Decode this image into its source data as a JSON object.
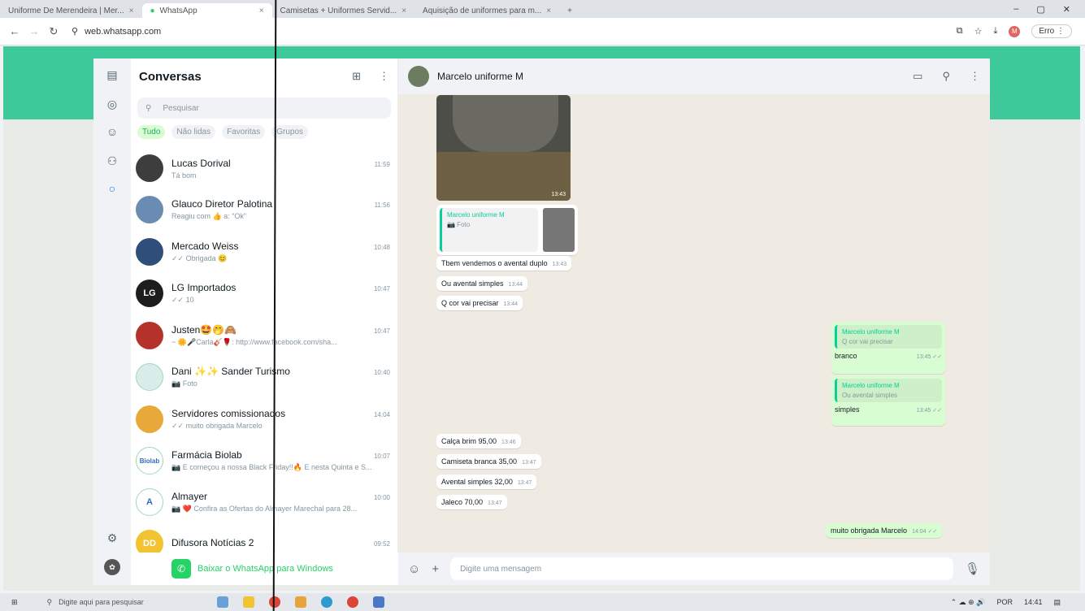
{
  "browser": {
    "tabs": [
      {
        "label": "Uniforme De Merendeira | Mer...",
        "active": false
      },
      {
        "label": "WhatsApp",
        "active": true
      },
      {
        "label": "Camisetas + Uniformes Servid...",
        "active": false
      },
      {
        "label": "Aquisição de uniformes para m...",
        "active": false
      }
    ],
    "url": "web.whatsapp.com",
    "error_label": "Erro"
  },
  "sidebar": {
    "title": "Conversas",
    "search_placeholder": "Pesquisar",
    "filters": [
      "Tudo",
      "Não lidas",
      "Favoritas",
      "Grupos"
    ],
    "chats": [
      {
        "name": "Lucas Dorival",
        "msg": "Tá bom",
        "time": "11:59",
        "color": "#3d3d3d",
        "initials": ""
      },
      {
        "name": "Glauco Diretor Palotina",
        "msg": "Reagiu com 👍 a: \"Ok\"",
        "time": "11:56",
        "color": "#6a8bb2",
        "initials": ""
      },
      {
        "name": "Mercado Weiss",
        "msg": "✓✓ Obrigada 😊",
        "time": "10:48",
        "color": "#2f4f7a",
        "initials": ""
      },
      {
        "name": "LG Importados",
        "msg": "✓✓ 10",
        "time": "10:47",
        "color": "#1d1d1d",
        "initials": "LG"
      },
      {
        "name": "Justen🤩🤭🙈",
        "msg": "~ 🌼🎤Carla🎸🌹: http://www.facebook.com/sha...",
        "time": "10:47",
        "color": "#b5322b",
        "initials": ""
      },
      {
        "name": "Dani ✨✨ Sander Turismo",
        "msg": "📷 Foto",
        "time": "10:40",
        "color": "#d8ecec",
        "initials": ""
      },
      {
        "name": "Servidores comissionados",
        "msg": "✓✓ muito obrigada Marcelo",
        "time": "14:04",
        "color": "#e9a93a",
        "initials": ""
      },
      {
        "name": "Farmácia Biolab",
        "msg": "📷 E começou a nossa Black Friday!!🔥 E nesta Quinta e S...",
        "time": "10:07",
        "color": "#ffffff",
        "initials": "Biolab"
      },
      {
        "name": "Almayer",
        "msg": "📷 ❤️ Confira as Ofertas do Almayer Marechal para 28...",
        "time": "10:00",
        "color": "#ffffff",
        "initials": "A"
      },
      {
        "name": "Difusora Notícias 2",
        "msg": "",
        "time": "09:52",
        "color": "#f1c232",
        "initials": "DD"
      }
    ],
    "download_label": "Baixar o WhatsApp para Windows"
  },
  "conversation": {
    "contact": "Marcelo uniforme M",
    "photo_time": "13:43",
    "reply_quote": {
      "name": "Marcelo uniforme M",
      "text": "📷 Foto"
    },
    "incoming_1": [
      {
        "text": "Tbem vendemos o avental duplo",
        "time": "13:43"
      },
      {
        "text": "Ou avental simples",
        "time": "13:44"
      },
      {
        "text": "Q cor vai precisar",
        "time": "13:44"
      }
    ],
    "outgoing_1": [
      {
        "quote_name": "Marcelo uniforme M",
        "quote_text": "Q cor vai precisar",
        "text": "branco",
        "time": "13:45 ✓✓"
      },
      {
        "quote_name": "Marcelo uniforme M",
        "quote_text": "Ou avental simples",
        "text": "simples",
        "time": "13:45 ✓✓"
      }
    ],
    "incoming_2": [
      {
        "text": "Calça brim 95,00",
        "time": "13:46"
      },
      {
        "text": "Camiseta branca 35,00",
        "time": "13:47"
      },
      {
        "text": "Avental simples 32,00",
        "time": "13:47"
      },
      {
        "text": "Jaleco 70,00",
        "time": "13:47"
      }
    ],
    "outgoing_2": {
      "text": "muito obrigada Marcelo",
      "time": "14:04 ✓✓"
    },
    "composer_placeholder": "Digite uma mensagem"
  },
  "taskbar": {
    "search_placeholder": "Digite aqui para pesquisar",
    "lang": "POR",
    "clock": "14:41"
  },
  "colors": {
    "brand": "#3ec99a",
    "accent_green": "#25d366",
    "outgoing_bubble": "#d9fdd3"
  }
}
